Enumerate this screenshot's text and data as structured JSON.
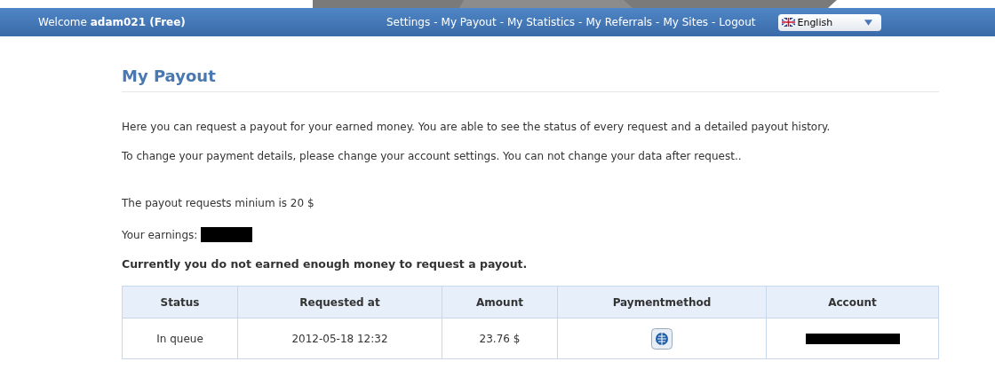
{
  "header": {
    "welcome": "Welcome **adam021 (Free)**",
    "nav_separator": "-",
    "nav": [
      "Settings",
      "My Payout",
      "My Statistics",
      "My Referrals",
      "My Sites",
      "Logout"
    ],
    "language": "English"
  },
  "page": {
    "title": "My Payout",
    "paragraphs": [
      "Here you can request a payout for your earned money. You are able to see the status of every request and a detailed payout history.",
      "To change your payment details, please change your account settings. You can not change your data after request.."
    ],
    "minimum": "The payout requests minium is 20 $",
    "earnings_label": "Your earnings:",
    "notice": "Currently you do not earned enough money to request a payout."
  },
  "table": {
    "columns": [
      "Status",
      "Requested at",
      "Amount",
      "Paymentmethod",
      "Account"
    ],
    "rows": [
      {
        "status": "In queue",
        "requested_at": "2012-05-18 12:32",
        "amount": "23.76 $"
      }
    ]
  }
}
